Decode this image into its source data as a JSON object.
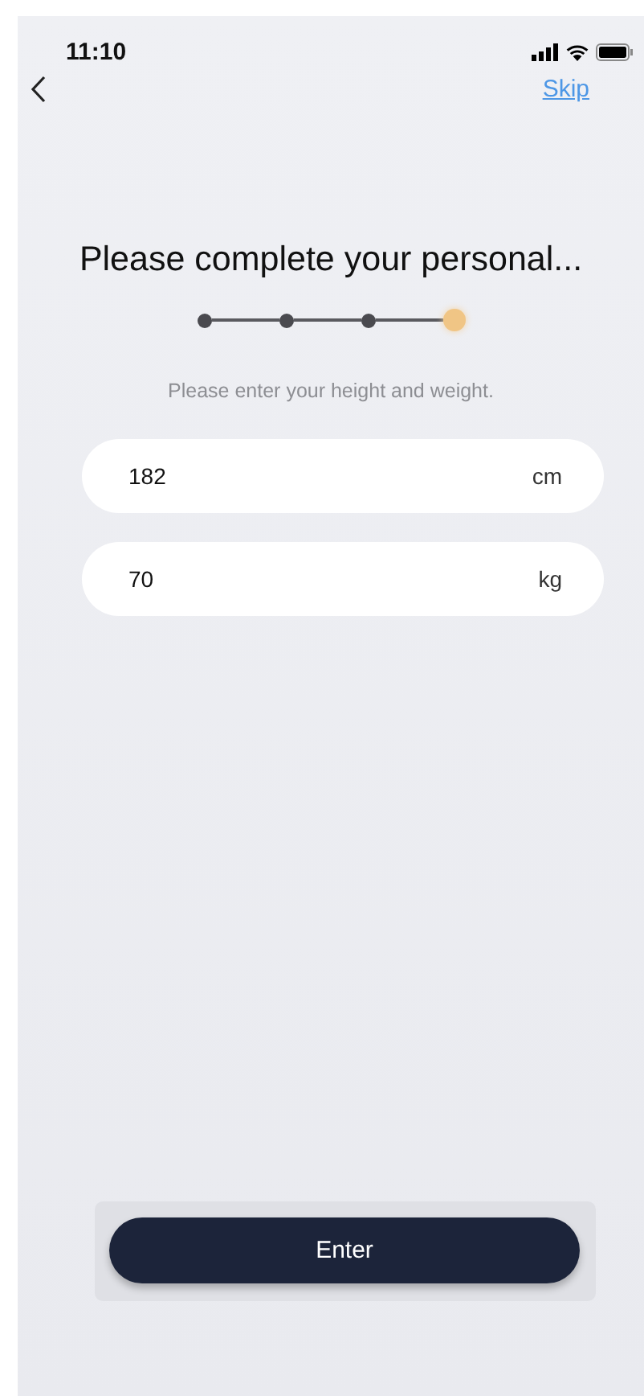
{
  "status_bar": {
    "time": "11:10"
  },
  "nav": {
    "skip": "Skip"
  },
  "title": "Please complete your personal...",
  "steps": [
    {
      "selected": false
    },
    {
      "selected": false
    },
    {
      "selected": false
    },
    {
      "selected": true
    }
  ],
  "hint": "Please enter your height and weight.",
  "fields": [
    {
      "value": "182",
      "unit": "cm"
    },
    {
      "value": "70",
      "unit": "kg"
    }
  ],
  "button": "Enter"
}
